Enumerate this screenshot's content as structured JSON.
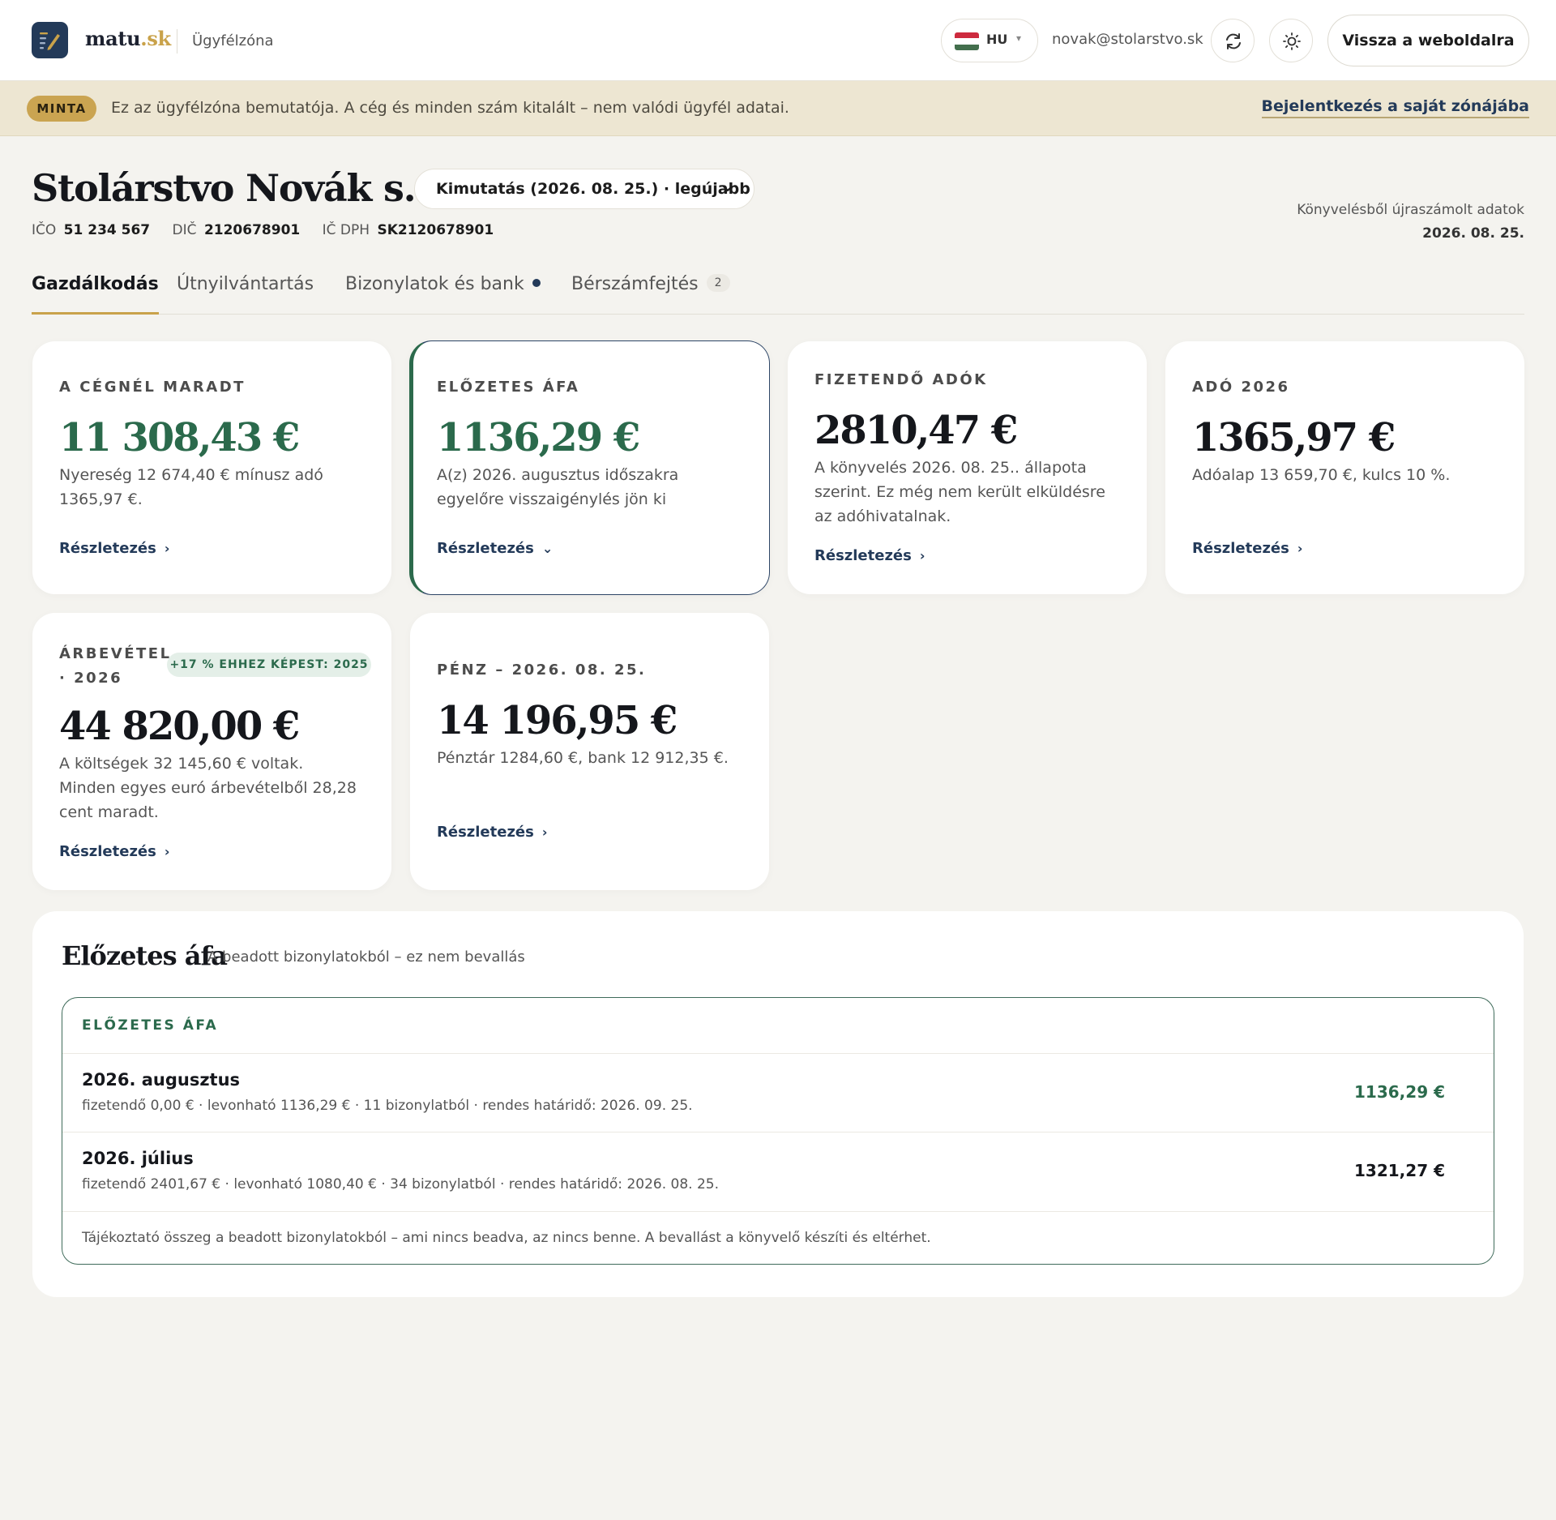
{
  "header": {
    "brand_main": "matu",
    "brand_accent": ".sk",
    "brand_sub": "Ügyfélzóna",
    "lang_code": "HU",
    "user_email": "novak@stolarstvo.sk",
    "back_label": "Vissza a weboldalra"
  },
  "banner": {
    "badge": "MINTA",
    "text": "Ez az ügyfélzóna bemutatója. A cég és minden szám kitalált – nem valódi ügyfél adatai.",
    "link": "Bejelentkezés a saját zónájába"
  },
  "company": {
    "name": "Stolárstvo Novák s. r. o.",
    "statement": "Kimutatás (2026. 08. 25.) · legújabb",
    "ico_label": "IČO",
    "ico": "51 234 567",
    "dic_label": "DIČ",
    "dic": "2120678901",
    "icdph_label": "IČ DPH",
    "icdph": "SK2120678901",
    "recalc_text": "Könyvelésből újraszámolt adatok",
    "recalc_date": "2026. 08. 25."
  },
  "tabs": [
    {
      "label": "Gazdálkodás"
    },
    {
      "label": "Útnyilvántartás"
    },
    {
      "label": "Bizonylatok és bank"
    },
    {
      "label": "Bérszámfejtés",
      "count": "2"
    }
  ],
  "cards": {
    "remained": {
      "label": "A cégnél maradt",
      "amount": "11 308,43 €",
      "desc": "Nyereség 12 674,40 € mínusz adó 1365,97 €.",
      "link": "Részletezés"
    },
    "prevat": {
      "label": "Előzetes áfa",
      "amount": "1136,29 €",
      "desc": "A(z) 2026. augusztus időszakra egyelőre visszaigénylés jön ki",
      "link": "Részletezés"
    },
    "taxes_due": {
      "label": "Fizetendő adók",
      "amount": "2810,47 €",
      "desc": "A könyvelés 2026. 08. 25.. állapota szerint. Ez még nem került elküldésre az adóhivatalnak.",
      "link": "Részletezés"
    },
    "tax2026": {
      "label": "Adó 2026",
      "amount": "1365,97 €",
      "desc": "Adóalap 13 659,70 €, kulcs 10 %.",
      "link": "Részletezés"
    },
    "revenue": {
      "label_line1": "Árbevétel",
      "label_line2": "· 2026",
      "badge": "+17 % EHHEZ KÉPEST: 2025",
      "amount": "44 820,00 €",
      "desc": "A költségek 32 145,60 € voltak. Minden egyes euró árbevételből 28,28 cent maradt.",
      "link": "Részletezés"
    },
    "cash": {
      "label": "Pénz – 2026. 08. 25.",
      "amount": "14 196,95 €",
      "desc": "Pénztár 1284,60 €, bank 12 912,35 €.",
      "link": "Részletezés"
    }
  },
  "vat_panel": {
    "title": "Előzetes áfa",
    "subtitle": "A beadott bizonylatokból – ez nem bevallás",
    "box_heading": "Előzetes áfa",
    "rows": [
      {
        "name": "2026. augusztus",
        "meta": "fizetendő 0,00 € · levonható 1136,29 € · 11 bizonylatból · rendes határidő: 2026. 09. 25.",
        "value": "1136,29 €"
      },
      {
        "name": "2026. július",
        "meta": "fizetendő 2401,67 € · levonható 1080,40 € · 34 bizonylatból · rendes határidő: 2026. 08. 25.",
        "value": "1321,27 €"
      }
    ],
    "note": "Tájékoztató összeg a beadott bizonylatokból – ami nincs beadva, az nincs benne. A bevallást a könyvelő készíti és eltérhet."
  },
  "colors": {
    "accent_gold": "#c9a24a",
    "navy": "#233a59",
    "green": "#2b6a4c"
  }
}
